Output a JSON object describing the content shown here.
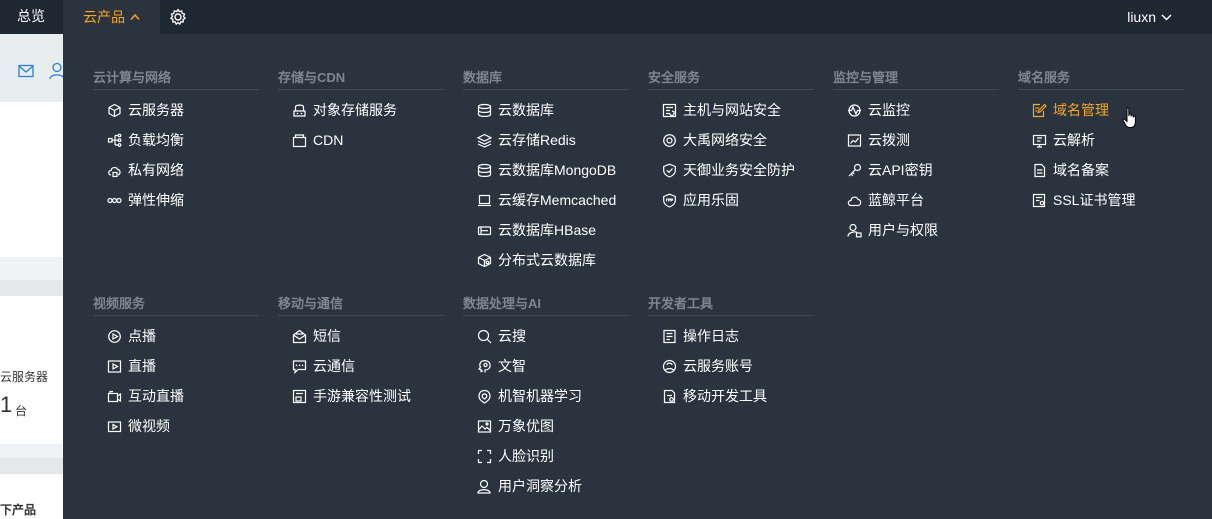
{
  "topbar": {
    "overview": "总览",
    "products": "云产品",
    "user": "liuxn"
  },
  "left_page": {
    "ecs_label": "云服务器",
    "ecs_count": "1",
    "ecs_unit": "台",
    "section_title": "下产品"
  },
  "menu": {
    "categories": [
      {
        "title": "云计算与网络",
        "items": [
          {
            "label": "云服务器",
            "icon": "cube-icon"
          },
          {
            "label": "负载均衡",
            "icon": "load-balance-icon"
          },
          {
            "label": "私有网络",
            "icon": "cloud-lock-icon"
          },
          {
            "label": "弹性伸缩",
            "icon": "elastic-icon"
          }
        ]
      },
      {
        "title": "存储与CDN",
        "items": [
          {
            "label": "对象存储服务",
            "icon": "storage-icon"
          },
          {
            "label": "CDN",
            "icon": "cdn-icon"
          }
        ]
      },
      {
        "title": "数据库",
        "items": [
          {
            "label": "云数据库",
            "icon": "database-icon"
          },
          {
            "label": "云存储Redis",
            "icon": "layers-icon"
          },
          {
            "label": "云数据库MongoDB",
            "icon": "database-icon"
          },
          {
            "label": "云缓存Memcached",
            "icon": "laptop-icon"
          },
          {
            "label": "云数据库HBase",
            "icon": "hbase-icon"
          },
          {
            "label": "分布式云数据库",
            "icon": "distributed-db-icon"
          }
        ]
      },
      {
        "title": "安全服务",
        "items": [
          {
            "label": "主机与网站安全",
            "icon": "host-security-icon"
          },
          {
            "label": "大禹网络安全",
            "icon": "gear-shield-icon"
          },
          {
            "label": "天御业务安全防护",
            "icon": "shield-icon"
          },
          {
            "label": "应用乐固",
            "icon": "app-shield-icon"
          }
        ]
      },
      {
        "title": "监控与管理",
        "items": [
          {
            "label": "云监控",
            "icon": "monitor-icon"
          },
          {
            "label": "云拨测",
            "icon": "chart-icon"
          },
          {
            "label": "云API密钥",
            "icon": "key-icon"
          },
          {
            "label": "蓝鲸平台",
            "icon": "cloud-icon"
          },
          {
            "label": "用户与权限",
            "icon": "user-lock-icon"
          }
        ]
      },
      {
        "title": "域名服务",
        "items": [
          {
            "label": "域名管理",
            "icon": "edit-doc-icon",
            "active": true
          },
          {
            "label": "云解析",
            "icon": "resolve-icon"
          },
          {
            "label": "域名备案",
            "icon": "record-icon"
          },
          {
            "label": "SSL证书管理",
            "icon": "certificate-icon"
          }
        ]
      },
      {
        "title": "视频服务",
        "items": [
          {
            "label": "点播",
            "icon": "vod-icon"
          },
          {
            "label": "直播",
            "icon": "live-icon"
          },
          {
            "label": "互动直播",
            "icon": "camera-icon"
          },
          {
            "label": "微视频",
            "icon": "video-icon"
          }
        ]
      },
      {
        "title": "移动与通信",
        "items": [
          {
            "label": "短信",
            "icon": "mail-open-icon"
          },
          {
            "label": "云通信",
            "icon": "chat-icon"
          },
          {
            "label": "手游兼容性测试",
            "icon": "test-icon"
          }
        ]
      },
      {
        "title": "数据处理与AI",
        "items": [
          {
            "label": "云搜",
            "icon": "search-icon"
          },
          {
            "label": "文智",
            "icon": "brain-icon"
          },
          {
            "label": "机智机器学习",
            "icon": "ml-icon"
          },
          {
            "label": "万象优图",
            "icon": "image-icon"
          },
          {
            "label": "人脸识别",
            "icon": "face-scan-icon"
          },
          {
            "label": "用户洞察分析",
            "icon": "user-insight-icon"
          }
        ]
      },
      {
        "title": "开发者工具",
        "items": [
          {
            "label": "操作日志",
            "icon": "log-icon"
          },
          {
            "label": "云服务账号",
            "icon": "account-icon"
          },
          {
            "label": "移动开发工具",
            "icon": "mobile-dev-icon"
          }
        ]
      }
    ]
  },
  "colors": {
    "accent": "#f5a623",
    "menu_bg": "#2a333e",
    "topbar_bg": "#1f2731",
    "category_title": "#7d8792"
  }
}
